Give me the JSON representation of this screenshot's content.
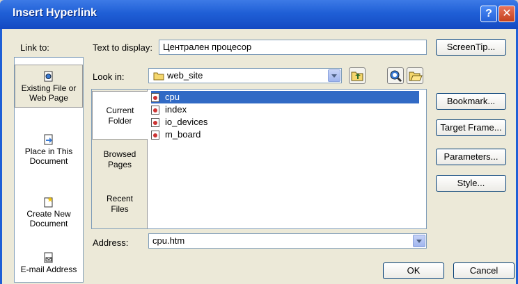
{
  "window": {
    "title": "Insert Hyperlink",
    "help_label": "?",
    "close_label": "✕"
  },
  "link_to": {
    "label": "Link to:",
    "items": [
      {
        "label_line1": "Existing File or",
        "label_line2": "Web Page"
      },
      {
        "label_line1": "Place in This",
        "label_line2": "Document"
      },
      {
        "label_line1": "Create New",
        "label_line2": "Document"
      },
      {
        "label_line1": "E-mail Address",
        "label_line2": ""
      }
    ]
  },
  "text_to_display": {
    "label": "Text to display:",
    "value": "Централен процесор"
  },
  "screentip_label": "ScreenTip...",
  "look_in": {
    "label": "Look in:",
    "value": "web_site"
  },
  "browse_tabs": [
    {
      "line1": "Current",
      "line2": "Folder"
    },
    {
      "line1": "Browsed",
      "line2": "Pages"
    },
    {
      "line1": "Recent",
      "line2": "Files"
    }
  ],
  "files": [
    "cpu",
    "index",
    "io_devices",
    "m_board"
  ],
  "right_buttons": {
    "bookmark": "Bookmark...",
    "target_frame": "Target Frame...",
    "parameters": "Parameters...",
    "style": "Style..."
  },
  "address": {
    "label": "Address:",
    "value": "cpu.htm"
  },
  "ok_label": "OK",
  "cancel_label": "Cancel",
  "colors": {
    "titlebar": "#1f5fd6",
    "selection": "#316ac5",
    "dialog_bg": "#ece9d8"
  }
}
